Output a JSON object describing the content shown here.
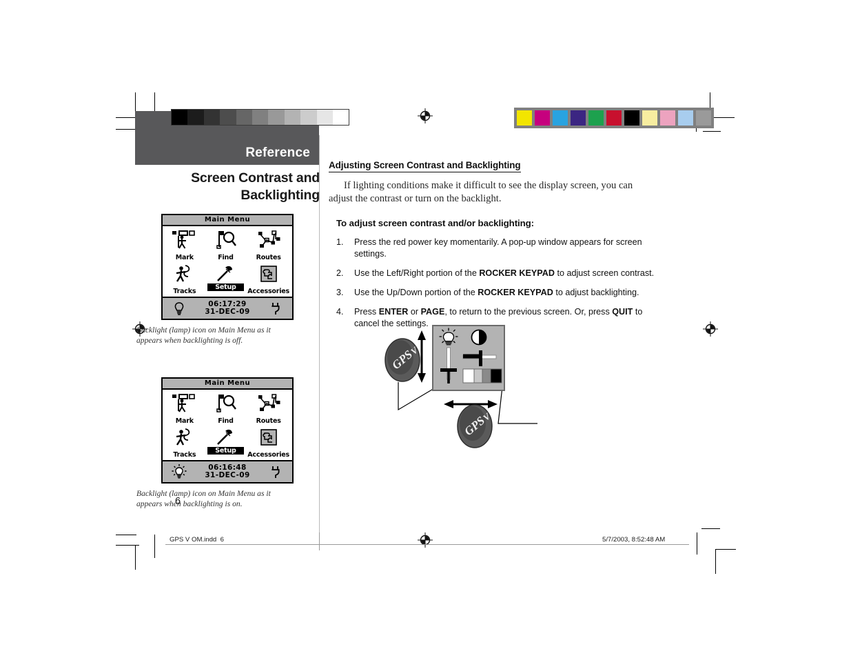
{
  "header": {
    "section_label": "Reference"
  },
  "left_column": {
    "section_title_line1": "Screen Contrast and",
    "section_title_line2": "Backlighting",
    "figure_off": {
      "screen_title": "Main Menu",
      "items": [
        {
          "label": "Mark",
          "icon": "mark-flag-person-icon",
          "selected": false
        },
        {
          "label": "Find",
          "icon": "find-magnifier-icon",
          "selected": false
        },
        {
          "label": "Routes",
          "icon": "routes-waypoints-icon",
          "selected": false
        },
        {
          "label": "Tracks",
          "icon": "tracks-walking-icon",
          "selected": false
        },
        {
          "label": "Setup",
          "icon": "setup-hammer-icon",
          "selected": true
        },
        {
          "label": "Accessories",
          "icon": "accessories-puzzle-icon",
          "selected": false
        }
      ],
      "time": "06:17:29",
      "date": "31-DEC-09",
      "lamp_icon": "backlight-lamp-off-icon",
      "power_icon": "external-power-plug-icon"
    },
    "caption_off_line1": "Backlight (lamp) icon on Main Menu as it",
    "caption_off_line2": "appears when backlighting is off.",
    "figure_on": {
      "screen_title": "Main Menu",
      "items": [
        {
          "label": "Mark",
          "icon": "mark-flag-person-icon",
          "selected": false
        },
        {
          "label": "Find",
          "icon": "find-magnifier-icon",
          "selected": false
        },
        {
          "label": "Routes",
          "icon": "routes-waypoints-icon",
          "selected": false
        },
        {
          "label": "Tracks",
          "icon": "tracks-walking-icon",
          "selected": false
        },
        {
          "label": "Setup",
          "icon": "setup-hammer-icon",
          "selected": true
        },
        {
          "label": "Accessories",
          "icon": "accessories-puzzle-icon",
          "selected": false
        }
      ],
      "time": "06:16:48",
      "date": "31-DEC-09",
      "lamp_icon": "backlight-lamp-on-icon",
      "power_icon": "external-power-plug-icon"
    },
    "caption_on_line1": "Backlight (lamp) icon on Main Menu as it",
    "caption_on_line2": "appears when backlighting is on."
  },
  "right_column": {
    "subhead": "Adjusting Screen Contrast and Backlighting",
    "intro": "If lighting conditions make it difficult to see the display screen, you can adjust the contrast or turn on the backlight.",
    "steps_heading": "To adjust screen contrast and/or backlighting:",
    "steps": [
      {
        "num": "1.",
        "parts": [
          {
            "t": "Press the red power key momentarily. A pop-up window appears for screen settings.",
            "b": false
          }
        ]
      },
      {
        "num": "2.",
        "parts": [
          {
            "t": "Use the Left/Right portion of the ",
            "b": false
          },
          {
            "t": "ROCKER KEYPAD",
            "b": true
          },
          {
            "t": " to adjust screen contrast.",
            "b": false
          }
        ]
      },
      {
        "num": "3.",
        "parts": [
          {
            "t": "Use the Up/Down portion of the ",
            "b": false
          },
          {
            "t": "ROCKER KEYPAD",
            "b": true
          },
          {
            "t": " to adjust backlighting.",
            "b": false
          }
        ]
      },
      {
        "num": "4.",
        "parts": [
          {
            "t": "Press ",
            "b": false
          },
          {
            "t": "ENTER",
            "b": true
          },
          {
            "t": " or ",
            "b": false
          },
          {
            "t": "PAGE",
            "b": true
          },
          {
            "t": ", to return to the previous screen. Or, press ",
            "b": false
          },
          {
            "t": "QUIT",
            "b": true
          },
          {
            "t": " to cancel the settings.",
            "b": false
          }
        ]
      }
    ]
  },
  "illustration": {
    "popup_name": "screen-settings-popup",
    "backlight_icon": "lightbulb-icon",
    "contrast_icon": "contrast-half-circle-icon",
    "vertical_arrow": "up-down-arrow",
    "horizontal_arrow": "left-right-arrow",
    "callout_top_label": "GPS V",
    "callout_bottom_label": "GPS V"
  },
  "prepress": {
    "gray_wedge": [
      "#000000",
      "#1c1c1c",
      "#333333",
      "#4d4d4d",
      "#666666",
      "#808080",
      "#999999",
      "#b3b3b3",
      "#cccccc",
      "#e6e6e6",
      "#ffffff"
    ],
    "color_bar": [
      "#f2e500",
      "#c6017e",
      "#29a3e0",
      "#3b2682",
      "#1da14e",
      "#c8102e",
      "#000000",
      "#f7eda0",
      "#eda3bf",
      "#a8cdee",
      "#9a9a9a"
    ],
    "registration_mark": "registration-target-icon",
    "header_gray": "#58585a"
  },
  "footer": {
    "filename": "GPS V OM.indd",
    "filepage": "6",
    "timestamp": "5/7/2003, 8:52:48 AM",
    "page_number": "6"
  }
}
